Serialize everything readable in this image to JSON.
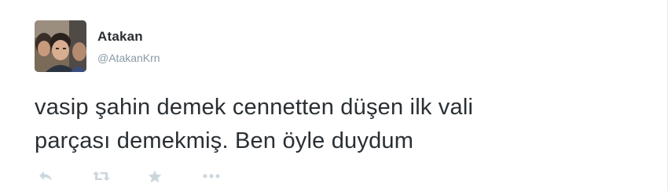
{
  "tweet": {
    "author": {
      "display_name": "Atakan",
      "handle": "@AtakanKrn",
      "avatar": "profile-photo"
    },
    "text": "vasip şahin demek cennetten düşen ilk vali\nparçası demekmiş. Ben öyle duydum",
    "actions": [
      {
        "name": "reply",
        "icon": "reply-icon"
      },
      {
        "name": "retweet",
        "icon": "retweet-icon"
      },
      {
        "name": "favorite",
        "icon": "star-icon"
      },
      {
        "name": "more",
        "icon": "more-icon"
      }
    ]
  },
  "colors": {
    "text": "#292f33",
    "secondary": "#8899a6",
    "action_icons": "#ccd6dd",
    "background": "#ffffff"
  }
}
